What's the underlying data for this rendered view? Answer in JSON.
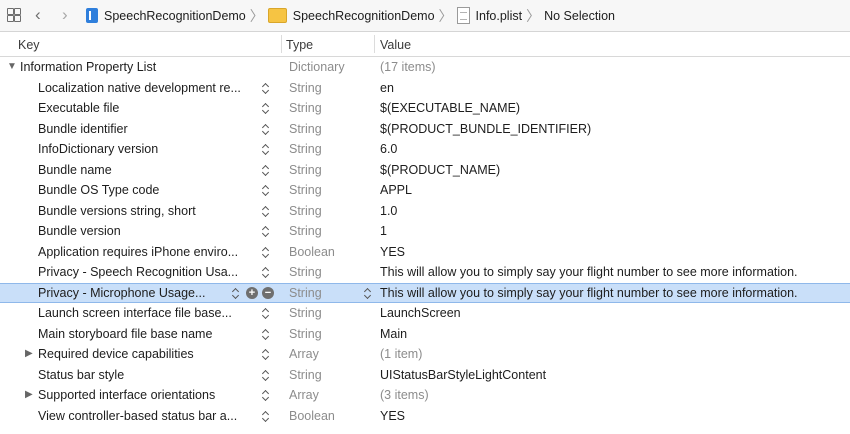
{
  "jumpbar": {
    "crumbs": [
      "SpeechRecognitionDemo",
      "SpeechRecognitionDemo",
      "Info.plist",
      "No Selection"
    ]
  },
  "columns": {
    "key": "Key",
    "type": "Type",
    "value": "Value"
  },
  "rows": [
    {
      "key": "Information Property List",
      "type": "Dictionary",
      "value": "(17 items)"
    },
    {
      "key": "Localization native development re...",
      "type": "String",
      "value": "en"
    },
    {
      "key": "Executable file",
      "type": "String",
      "value": "$(EXECUTABLE_NAME)"
    },
    {
      "key": "Bundle identifier",
      "type": "String",
      "value": "$(PRODUCT_BUNDLE_IDENTIFIER)"
    },
    {
      "key": "InfoDictionary version",
      "type": "String",
      "value": "6.0"
    },
    {
      "key": "Bundle name",
      "type": "String",
      "value": "$(PRODUCT_NAME)"
    },
    {
      "key": "Bundle OS Type code",
      "type": "String",
      "value": "APPL"
    },
    {
      "key": "Bundle versions string, short",
      "type": "String",
      "value": "1.0"
    },
    {
      "key": "Bundle version",
      "type": "String",
      "value": "1"
    },
    {
      "key": "Application requires iPhone enviro...",
      "type": "Boolean",
      "value": "YES"
    },
    {
      "key": "Privacy - Speech Recognition Usa...",
      "type": "String",
      "value": "This will allow you to simply say your flight number to see more information."
    },
    {
      "key": "Privacy - Microphone Usage...",
      "type": "String",
      "value": "This will allow you to simply say your flight number to see more information."
    },
    {
      "key": "Launch screen interface file base...",
      "type": "String",
      "value": "LaunchScreen"
    },
    {
      "key": "Main storyboard file base name",
      "type": "String",
      "value": "Main"
    },
    {
      "key": "Required device capabilities",
      "type": "Array",
      "value": "(1 item)"
    },
    {
      "key": "Status bar style",
      "type": "String",
      "value": "UIStatusBarStyleLightContent"
    },
    {
      "key": "Supported interface orientations",
      "type": "Array",
      "value": "(3 items)"
    },
    {
      "key": "View controller-based status bar a...",
      "type": "Boolean",
      "value": "YES"
    }
  ]
}
